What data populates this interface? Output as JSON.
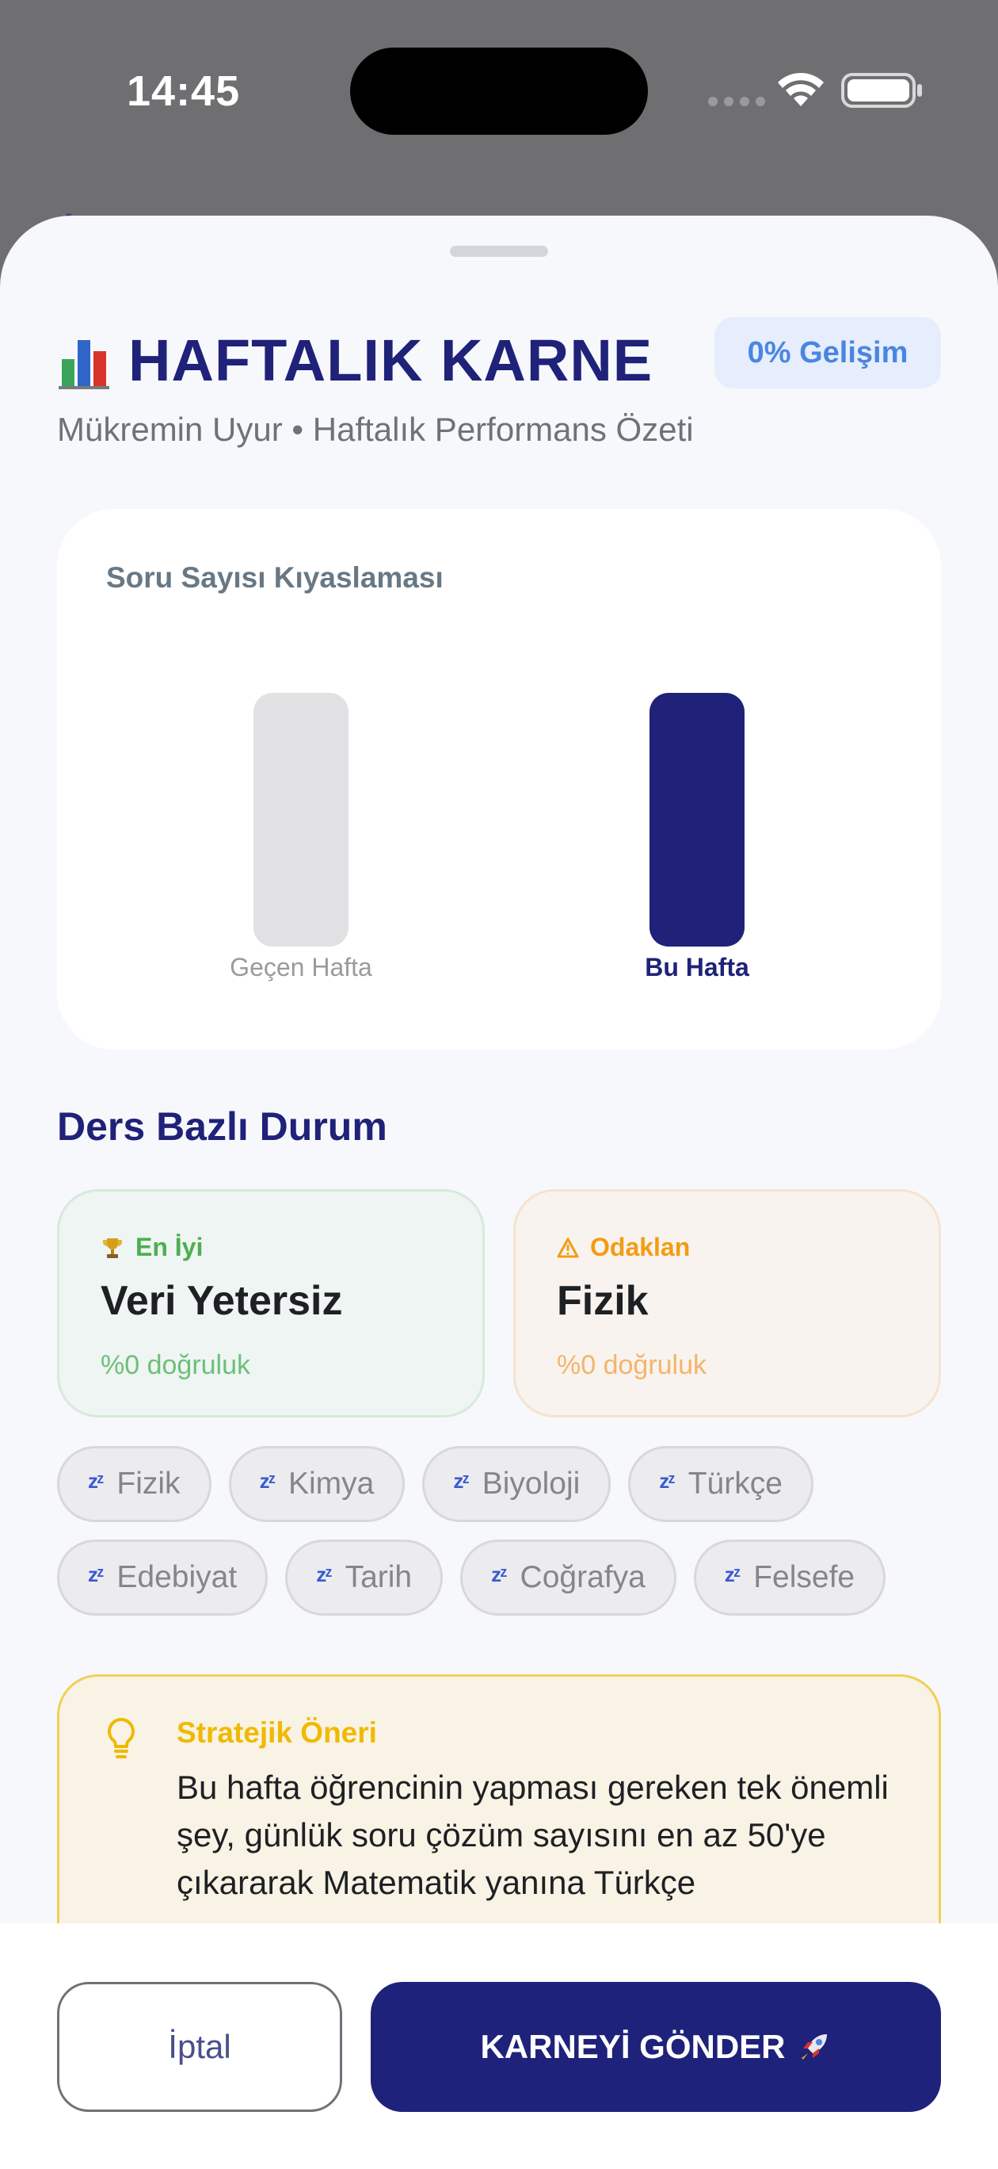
{
  "status": {
    "time": "14:45"
  },
  "header": {
    "title": "HAFTALIK KARNE",
    "badge": "0% Gelişim",
    "subtitle": "Mükremin Uyur • Haftalık Performans Özeti"
  },
  "chart_card": {
    "title": "Soru Sayısı Kıyaslaması",
    "colors": {
      "previous": "#e1e1e3",
      "current": "#1f2278"
    }
  },
  "chart_data": {
    "type": "bar",
    "title": "Soru Sayısı Kıyaslaması",
    "categories": [
      "Geçen Hafta",
      "Bu Hafta"
    ],
    "values": [
      0,
      0
    ],
    "xlabel": "",
    "ylabel": ""
  },
  "subjects": {
    "section_title": "Ders Bazlı Durum",
    "best": {
      "tag": "En İyi",
      "name": "Veri Yetersiz",
      "accuracy": "%0 doğruluk",
      "icon": "trophy-icon"
    },
    "focus": {
      "tag": "Odaklan",
      "name": "Fizik",
      "accuracy": "%0 doğruluk",
      "icon": "warning-icon"
    },
    "chips_row1": [
      "Fizik",
      "Kimya",
      "Biyoloji",
      "Türkçe"
    ],
    "chips_row2": [
      "Edebiyat",
      "Tarih",
      "Coğrafya",
      "Felsefe"
    ]
  },
  "advice": {
    "title": "Stratejik Öneri",
    "text": "Bu hafta öğrencinin yapması gereken tek önemli şey, günlük soru çözüm sayısını en az 50'ye çıkararak Matematik yanına Türkçe"
  },
  "footer": {
    "cancel_label": "İptal",
    "send_label": "KARNEYİ GÖNDER"
  }
}
